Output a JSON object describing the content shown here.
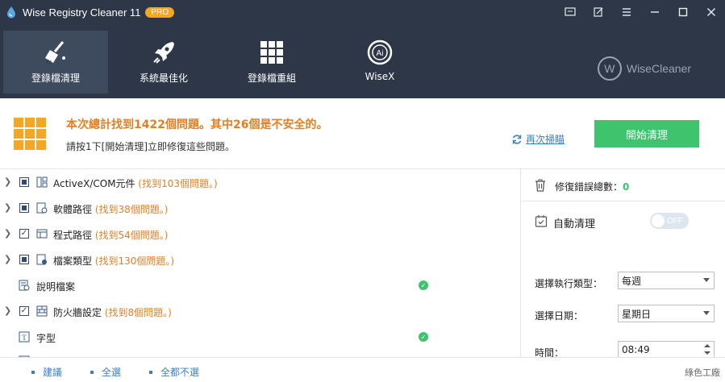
{
  "app": {
    "title": "Wise Registry Cleaner 11",
    "badge": "PRO"
  },
  "window_controls": [
    "feedback-icon",
    "edit-icon",
    "menu-icon",
    "minimize-icon",
    "maximize-icon",
    "close-icon"
  ],
  "nav": {
    "items": [
      {
        "label": "登錄檔清理",
        "icon": "broom-icon",
        "active": true
      },
      {
        "label": "系統最佳化",
        "icon": "rocket-icon",
        "active": false
      },
      {
        "label": "登錄檔重組",
        "icon": "grid-icon",
        "active": false
      },
      {
        "label": "WiseX",
        "icon": "ai-icon",
        "active": false
      }
    ],
    "brand": {
      "letter": "W",
      "name": "WiseCleaner"
    }
  },
  "summary": {
    "title": "本次總計找到1422個問題。其中26個是不安全的。",
    "subtitle": "請按1下[開始清理]立即修復這些問題。",
    "rescan_label": "再次掃瞄",
    "start_label": "開始清理"
  },
  "list": {
    "rows": [
      {
        "label": "ActiveX/COM元件",
        "count": "(找到103個問題。)",
        "expandable": true,
        "check": "partial",
        "status": ""
      },
      {
        "label": "軟體路徑",
        "count": "(找到38個問題。)",
        "expandable": true,
        "check": "partial",
        "status": ""
      },
      {
        "label": "程式路徑",
        "count": "(找到54個問題。)",
        "expandable": true,
        "check": "checked",
        "status": ""
      },
      {
        "label": "檔案類型",
        "count": "(找到130個問題。)",
        "expandable": true,
        "check": "partial",
        "status": ""
      },
      {
        "label": "說明檔案",
        "count": "",
        "expandable": false,
        "check": "none",
        "status": "ok"
      },
      {
        "label": "防火牆設定",
        "count": "(找到8個問題。)",
        "expandable": true,
        "check": "checked",
        "status": ""
      },
      {
        "label": "字型",
        "count": "",
        "expandable": false,
        "check": "none",
        "status": "ok"
      }
    ]
  },
  "panel": {
    "fix_label": "修復錯誤總數：",
    "fix_count": "0",
    "auto_label": "自動清理",
    "toggle_text": "OFF",
    "schedule_type_label": "選擇執行類型：",
    "schedule_type_value": "每週",
    "day_label": "選擇日期：",
    "day_value": "星期日",
    "time_label": "時間：",
    "time_value": "08:49"
  },
  "footer": {
    "recommended": "建議",
    "select_all": "全選",
    "select_none": "全都不選",
    "watermark": "綠色工廠"
  },
  "colors": {
    "header_bg": "#2d3748",
    "accent_orange": "#e67e22",
    "accent_green": "#3ec46d",
    "link_blue": "#3c7fc4"
  }
}
